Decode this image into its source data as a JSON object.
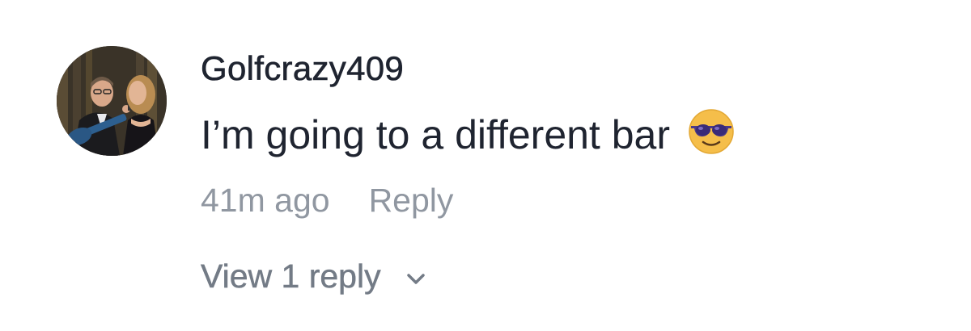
{
  "comment": {
    "username": "Golfcrazy409",
    "text": "I’m going to a different bar",
    "emoji_icon": "smiling-face-with-sunglasses-icon",
    "timestamp": "41m ago",
    "reply_label": "Reply",
    "view_replies_label": "View 1 reply",
    "avatar_icon": "user-avatar-photo"
  },
  "colors": {
    "text_primary": "#1f2430",
    "text_secondary": "#9097a1",
    "text_tertiary": "#737b86",
    "background": "#ffffff"
  }
}
